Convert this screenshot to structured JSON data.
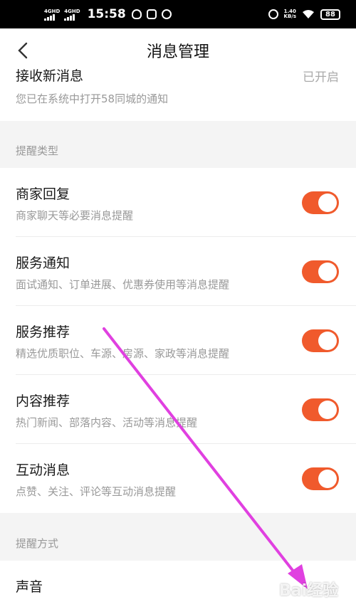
{
  "status_bar": {
    "network_1": "4GHD",
    "network_2": "4GHD",
    "time": "15:58",
    "net_speed_value": "1.40",
    "net_speed_unit": "KB/s",
    "battery": "88"
  },
  "nav": {
    "title": "消息管理",
    "back_icon": "chevron-left-icon"
  },
  "receive": {
    "title": "接收新消息",
    "status": "已开启",
    "subtitle": "您已在系统中打开58同城的通知"
  },
  "reminder_types": {
    "header": "提醒类型",
    "items": [
      {
        "title": "商家回复",
        "subtitle": "商家聊天等必要消息提醒",
        "enabled": true
      },
      {
        "title": "服务通知",
        "subtitle": "面试通知、订单进展、优惠券使用等消息提醒",
        "enabled": true
      },
      {
        "title": "服务推荐",
        "subtitle": "精选优质职位、车源、房源、家政等消息提醒",
        "enabled": true
      },
      {
        "title": "内容推荐",
        "subtitle": "热门新闻、部落内容、活动等消息提醒",
        "enabled": true
      },
      {
        "title": "互动消息",
        "subtitle": "点赞、关注、评论等互动消息提醒",
        "enabled": true
      }
    ]
  },
  "reminder_method": {
    "header": "提醒方式",
    "items": [
      {
        "title": "声音"
      }
    ]
  },
  "watermark": "Bai经验",
  "colors": {
    "toggle_on": "#f05a2c",
    "annotation_arrow": "#e040e0"
  }
}
